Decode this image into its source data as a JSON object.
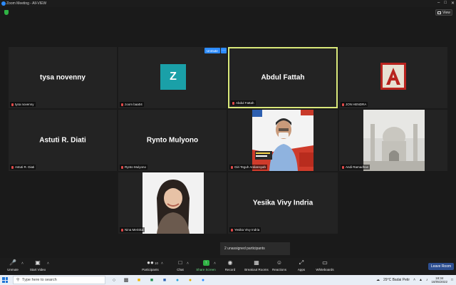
{
  "window": {
    "title": "Zoom Meeting - All-VIEW",
    "view_label": "View"
  },
  "controls_overlay": {
    "unmute_label": "Unmute",
    "more_label": "···"
  },
  "tiles": [
    {
      "big": "tysa novenny",
      "label": "tysa novenny"
    },
    {
      "avatar": "Z",
      "label": "zoom baa04"
    },
    {
      "big": "Abdul Fattah",
      "label": "Abdul Fattah"
    },
    {
      "label": "JON HENDRA"
    },
    {
      "big": "Astuti R. Diati",
      "label": "Astuti R. Diati"
    },
    {
      "big": "Rynto Mulyono",
      "label": "Rynto Mulyono"
    },
    {
      "label": "Giri Teguh Ardiansyah"
    },
    {
      "label": "Andi Ramadhan"
    },
    {
      "label": "Nina Meriska"
    },
    {
      "big": "Yesika Vivy Indria",
      "label": "Yesika Vivy Indria"
    }
  ],
  "unassigned_text": "2 unassigned participants",
  "toolbar": {
    "unmute": "Unmute",
    "start_video": "Start Video",
    "participants": "Participants",
    "participants_count": "10",
    "chat": "Chat",
    "share_screen": "Share Screen",
    "record": "Record",
    "breakout_rooms": "Breakout Rooms",
    "reactions": "Reactions",
    "apps": "Apps",
    "whiteboards": "Whiteboards",
    "leave_room": "Leave Room"
  },
  "taskbar": {
    "search_placeholder": "Type here to search",
    "weather": "29°C Badai Petir",
    "time": "18:34",
    "date": "18/05/2022"
  },
  "colors": {
    "zoom_blue": "#2d8cff",
    "active_speaker": "#d9e87a",
    "share_green": "#2fb344"
  }
}
